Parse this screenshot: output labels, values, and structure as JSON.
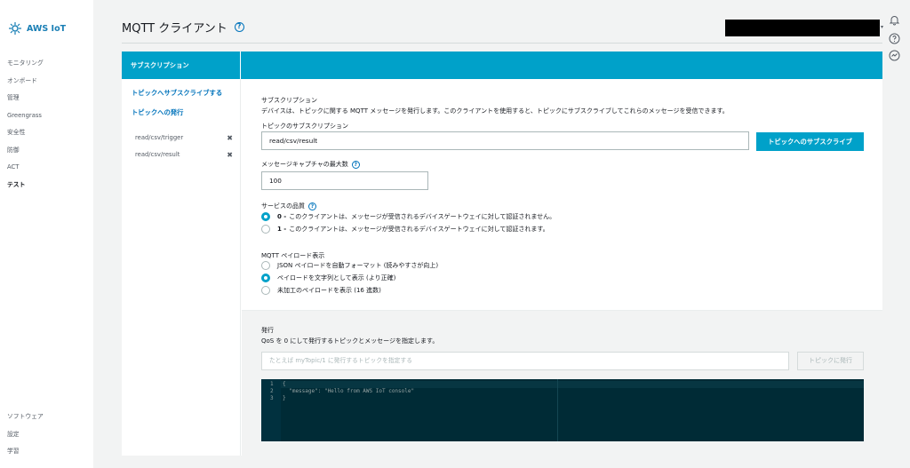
{
  "brand": {
    "name": "AWS IoT"
  },
  "sidebar": {
    "items": [
      {
        "label": "モニタリング",
        "active": false
      },
      {
        "label": "オンボード",
        "active": false
      },
      {
        "label": "管理",
        "active": false
      },
      {
        "label": "Greengrass",
        "active": false
      },
      {
        "label": "安全性",
        "active": false
      },
      {
        "label": "防御",
        "active": false
      },
      {
        "label": "ACT",
        "active": false
      },
      {
        "label": "テスト",
        "active": true
      }
    ],
    "bottom_items": [
      {
        "label": "ソフトウェア"
      },
      {
        "label": "設定"
      },
      {
        "label": "学習"
      }
    ]
  },
  "header": {
    "title": "MQTT クライアント",
    "help_icon": "help-circle-icon",
    "account_redacted": true
  },
  "right_icons": [
    "bell-icon",
    "help-circle-icon",
    "feedback-icon"
  ],
  "panel": {
    "tab_label": "サブスクリプション",
    "links": {
      "subscribe": "トピックへサブスクライブする",
      "publish": "トピックへの発行"
    },
    "subscriptions": [
      {
        "topic": "read/csv/trigger",
        "remove": "✖"
      },
      {
        "topic": "read/csv/result",
        "remove": "✖"
      }
    ]
  },
  "subscribe_form": {
    "section_title": "サブスクリプション",
    "description": "デバイスは、トピックに関する MQTT メッセージを発行します。このクライアントを使用すると、トピックにサブスクライブしてこれらのメッセージを受信できます。",
    "topic_label": "トピックのサブスクリプション",
    "topic_value": "read/csv/result",
    "subscribe_button": "トピックへのサブスクライブ",
    "max_capture_label": "メッセージキャプチャの最大数",
    "max_capture_value": "100",
    "qos_label": "サービスの品質",
    "qos_options": [
      {
        "bold": "0 -",
        "text": "このクライアントは、メッセージが受信されるデバイスゲートウェイに対して認証されません。",
        "checked": true
      },
      {
        "bold": "1 -",
        "text": "このクライアントは、メッセージが受信されるデバイスゲートウェイに対して認証されます。",
        "checked": false
      }
    ],
    "payload_label": "MQTT ペイロード表示",
    "payload_options": [
      {
        "text": "JSON ペイロードを自動フォーマット (読みやすさが向上)",
        "checked": false
      },
      {
        "text": "ペイロードを文字列として表示 (より正確)",
        "checked": true
      },
      {
        "text": "未加工のペイロードを表示 (16 進数)",
        "checked": false
      }
    ]
  },
  "publish_form": {
    "section_title": "発行",
    "description": "QoS を 0 にして発行するトピックとメッセージを指定します。",
    "topic_placeholder": "たとえば myTopic/1 に発行するトピックを指定する",
    "publish_button": "トピックに発行",
    "code_lines": [
      {
        "num": "1",
        "text": "{"
      },
      {
        "num": "2",
        "text": "  \"message\": \"Hello from AWS IoT console\""
      },
      {
        "num": "3",
        "text": "}"
      }
    ]
  },
  "colors": {
    "accent": "#00a1c9",
    "link": "#0073bb",
    "editor_bg": "#002b36"
  }
}
